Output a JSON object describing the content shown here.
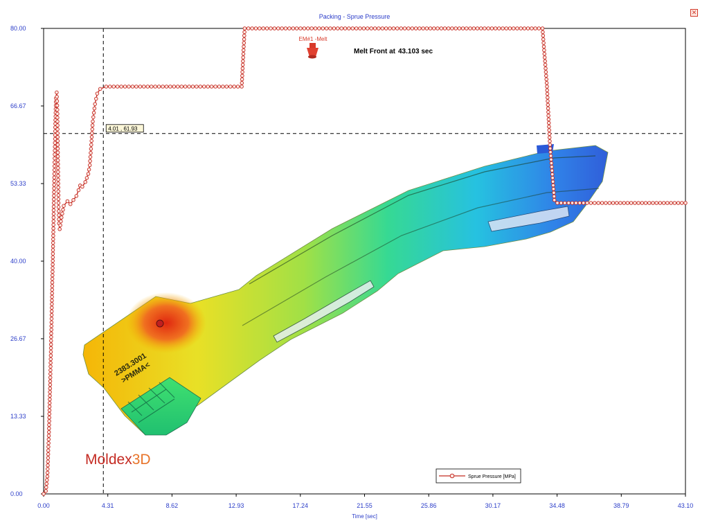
{
  "window": {
    "title": "Packing - Sprue Pressure",
    "close_glyph": "✕",
    "close_icon": "close-icon"
  },
  "overlay": {
    "melt_front_label": "Melt Front at",
    "melt_front_value": "43.103 sec",
    "em_label": "EM#1 -Melt",
    "em_marker_icon": "gate-marker-icon",
    "part_text_line1": "2383.3001",
    "part_text_line2": ">PMMA<"
  },
  "logo": {
    "text_main": "Moldex",
    "text_accent": "3D",
    "color_main": "#c42a22",
    "color_accent": "#e8742a"
  },
  "cursor": {
    "x": 4.01,
    "y": 61.93,
    "label": "4.01 , 61.93"
  },
  "colors": {
    "series": "#c42a22",
    "axis_text": "#2a3cc8",
    "cursor_line": "#000000"
  },
  "chart_data": {
    "type": "line",
    "title": "Packing - Sprue Pressure",
    "xlabel": "Time [sec]",
    "ylabel": "",
    "xlim": [
      0,
      43.1
    ],
    "ylim": [
      0,
      80
    ],
    "x_ticks": [
      "0.00",
      "4.31",
      "8.62",
      "12.93",
      "17.24",
      "21.55",
      "25.86",
      "30.17",
      "34.48",
      "38.79",
      "43.10"
    ],
    "y_ticks": [
      "0.00",
      "13.33",
      "26.67",
      "40.00",
      "53.33",
      "66.67",
      "80.00"
    ],
    "grid": false,
    "legend_position": "bottom-right",
    "series": [
      {
        "name": "Sprue Pressure [MPa]",
        "points": [
          [
            0,
            0
          ],
          [
            0.15,
            0.5
          ],
          [
            0.25,
            3
          ],
          [
            0.35,
            10
          ],
          [
            0.45,
            20
          ],
          [
            0.55,
            32
          ],
          [
            0.65,
            45
          ],
          [
            0.72,
            55
          ],
          [
            0.78,
            63
          ],
          [
            0.83,
            68
          ],
          [
            0.88,
            69
          ],
          [
            0.92,
            66
          ],
          [
            0.96,
            58
          ],
          [
            1.0,
            50
          ],
          [
            1.03,
            46.5
          ],
          [
            1.08,
            45.5
          ],
          [
            1.2,
            47.5
          ],
          [
            1.35,
            49.5
          ],
          [
            1.6,
            50.3
          ],
          [
            1.8,
            49.8
          ],
          [
            2.0,
            50.5
          ],
          [
            2.2,
            51.2
          ],
          [
            2.35,
            52.2
          ],
          [
            2.45,
            53
          ],
          [
            2.6,
            52.8
          ],
          [
            2.8,
            53.6
          ],
          [
            3.0,
            55
          ],
          [
            3.1,
            56.5
          ],
          [
            3.2,
            60
          ],
          [
            3.3,
            64
          ],
          [
            3.45,
            67
          ],
          [
            3.6,
            68.8
          ],
          [
            3.8,
            69.6
          ],
          [
            4.2,
            70
          ],
          [
            8.0,
            70
          ],
          [
            13.3,
            70
          ],
          [
            13.5,
            80
          ],
          [
            20.0,
            80
          ],
          [
            25.0,
            80
          ],
          [
            33.5,
            80
          ],
          [
            33.8,
            70
          ],
          [
            34.0,
            60
          ],
          [
            34.3,
            50.5
          ],
          [
            34.5,
            50
          ],
          [
            38.0,
            50
          ],
          [
            43.1,
            50
          ]
        ]
      }
    ]
  }
}
